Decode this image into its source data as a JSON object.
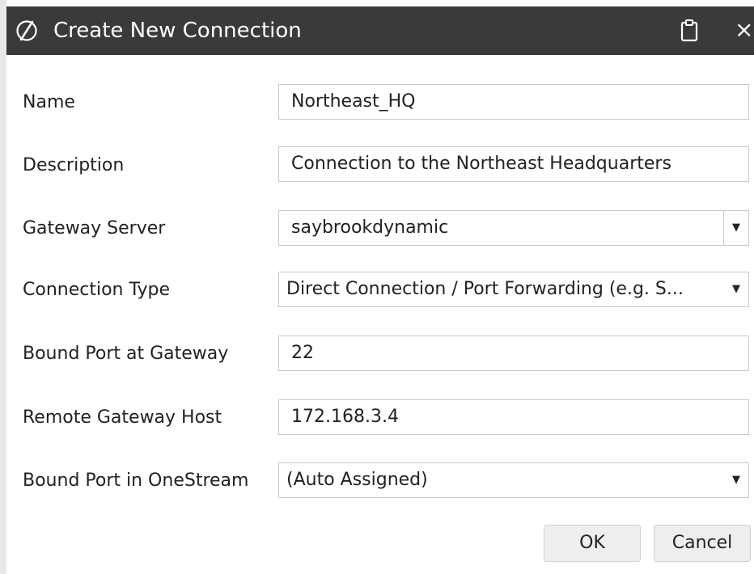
{
  "window": {
    "title": "Create New Connection",
    "logo_icon": "onestream-logo-icon",
    "clipboard_icon": "clipboard-icon",
    "close_icon": "close-icon",
    "close_glyph": "×"
  },
  "form": {
    "name": {
      "label": "Name",
      "value": "Northeast_HQ"
    },
    "description": {
      "label": "Description",
      "value": "Connection to the Northeast Headquarters"
    },
    "gateway_server": {
      "label": "Gateway Server",
      "value": "saybrookdynamic"
    },
    "connection_type": {
      "label": "Connection Type",
      "value": "Direct Connection / Port Forwarding (e.g. S..."
    },
    "bound_port_gateway": {
      "label": "Bound Port at Gateway",
      "value": "22"
    },
    "remote_gateway_host": {
      "label": "Remote Gateway Host",
      "value": "172.168.3.4"
    },
    "bound_port_onestream": {
      "label": "Bound Port in OneStream",
      "value": "(Auto Assigned)"
    },
    "dropdown_arrow": "▼"
  },
  "buttons": {
    "ok": "OK",
    "cancel": "Cancel"
  },
  "colors": {
    "titlebar": "#3a3a3a",
    "field_border": "#c9c9c9",
    "button_bg": "#eeeeee"
  }
}
